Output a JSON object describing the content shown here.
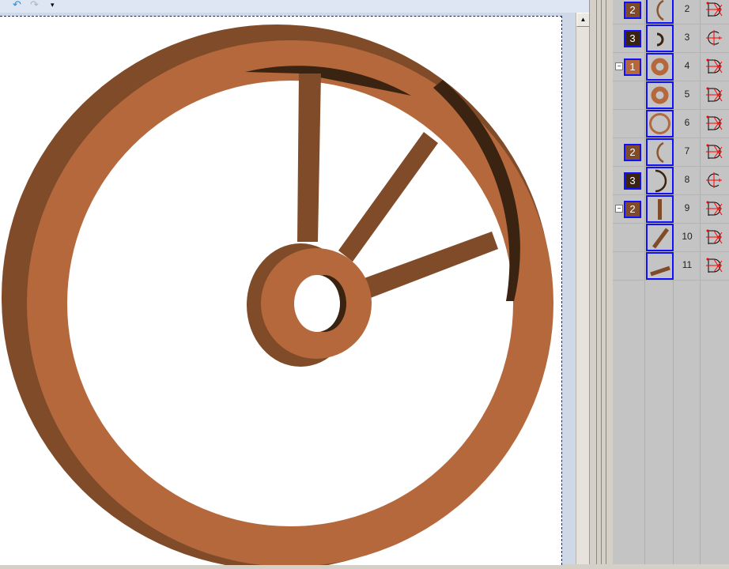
{
  "toolbar": {
    "undo_icon": "undo-icon",
    "redo_icon": "redo-icon",
    "dropdown_icon": "customize-dropdown-icon"
  },
  "colors": {
    "front": "#b5683c",
    "side": "#7f4b29",
    "shadow": "#3b2312",
    "selection": "#1010ff"
  },
  "rows": [
    {
      "number": "2",
      "material": "2",
      "shape": "arc-left",
      "icon": "mesh-node-icon"
    },
    {
      "number": "3",
      "material": "3",
      "shape": "arc-small",
      "icon": "group-node-icon"
    },
    {
      "number": "4",
      "material": "1",
      "shape": "ring-thick",
      "icon": "mesh-node-icon",
      "collapsible": true
    },
    {
      "number": "5",
      "material": "",
      "shape": "ring-thick",
      "icon": "mesh-node-icon"
    },
    {
      "number": "6",
      "material": "",
      "shape": "ring-thin",
      "icon": "mesh-node-icon"
    },
    {
      "number": "7",
      "material": "2",
      "shape": "arc-left",
      "icon": "mesh-node-icon"
    },
    {
      "number": "8",
      "material": "3",
      "shape": "arc-right",
      "icon": "group-node-icon"
    },
    {
      "number": "9",
      "material": "2",
      "shape": "spoke-vertical",
      "icon": "mesh-node-icon",
      "collapsible": true
    },
    {
      "number": "10",
      "material": "",
      "shape": "spoke-diagonal",
      "icon": "mesh-node-icon"
    },
    {
      "number": "11",
      "material": "",
      "shape": "spoke-flat",
      "icon": "mesh-node-icon"
    }
  ]
}
